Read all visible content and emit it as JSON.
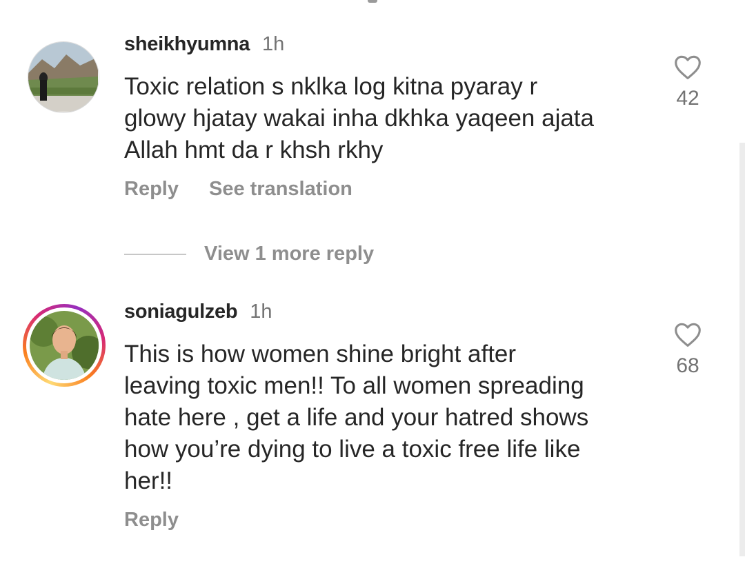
{
  "comments": [
    {
      "username": "sheikhyumna",
      "time": "1h",
      "text": "Toxic relation s nklka log kitna pyaray r\nglowy hjatay wakai inha dkhka yaqeen ajata\nAllah hmt da r khsh rkhy",
      "likes": "42",
      "reply_label": "Reply",
      "translate_label": "See translation",
      "avatar_icon": "landscape-photo-avatar"
    },
    {
      "username": "soniagulzeb",
      "time": "1h",
      "text": "This is how women shine bright after\nleaving toxic men!! To all women spreading\nhate here , get a life and your hatred shows\nhow you’re dying to live a toxic free life like\nher!!",
      "likes": "68",
      "reply_label": "Reply",
      "avatar_icon": "portrait-photo-avatar"
    }
  ],
  "view_more_label": "View 1 more reply",
  "icons": {
    "like": "heart-outline-icon"
  },
  "colors": {
    "text_primary": "#262626",
    "text_secondary": "#8e8e8e",
    "story_ring_start": "#feda75",
    "story_ring_end": "#d62976"
  }
}
